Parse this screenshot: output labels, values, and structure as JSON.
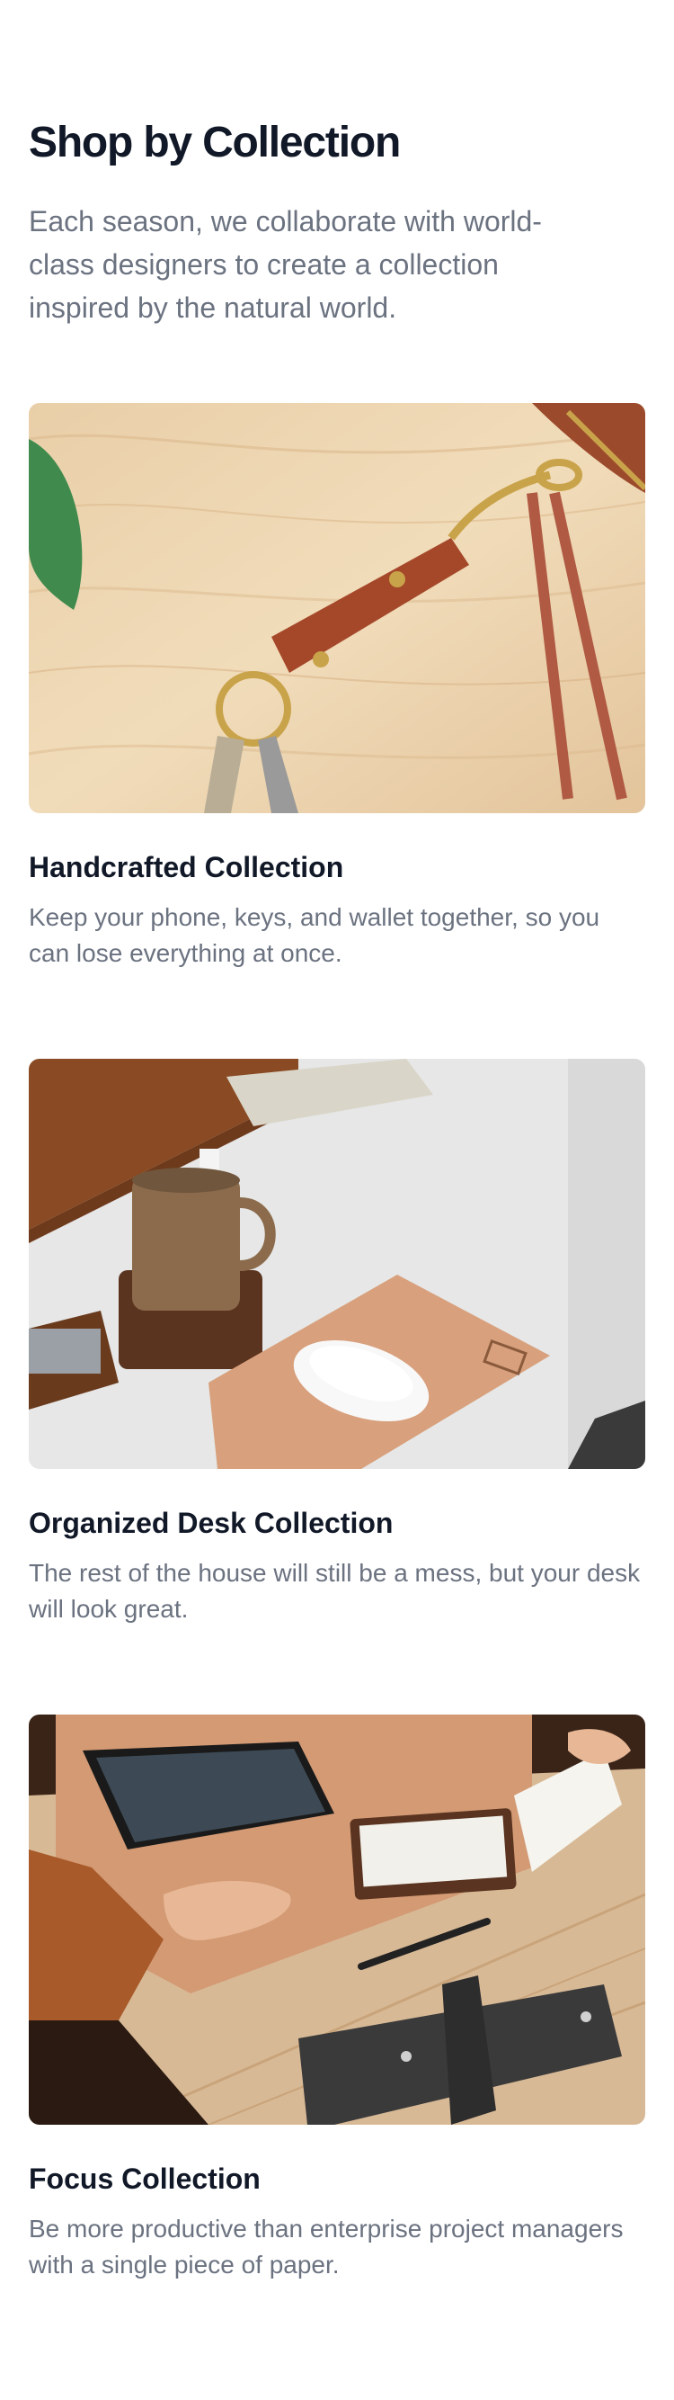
{
  "header": {
    "title": "Shop by Collection",
    "subtitle": "Each season, we collaborate with world-class designers to create a collection inspired by the natural world."
  },
  "collections": [
    {
      "name": "Handcrafted Collection",
      "description": "Keep your phone, keys, and wallet together, so you can lose everything at once.",
      "image": "leather-keychain-photo"
    },
    {
      "name": "Organized Desk Collection",
      "description": "The rest of the house will still be a mess, but your desk will look great.",
      "image": "desk-mouse-mug-photo"
    },
    {
      "name": "Focus Collection",
      "description": "Be more productive than enterprise project managers with a single piece of paper.",
      "image": "desk-notepad-tablet-photo"
    }
  ]
}
